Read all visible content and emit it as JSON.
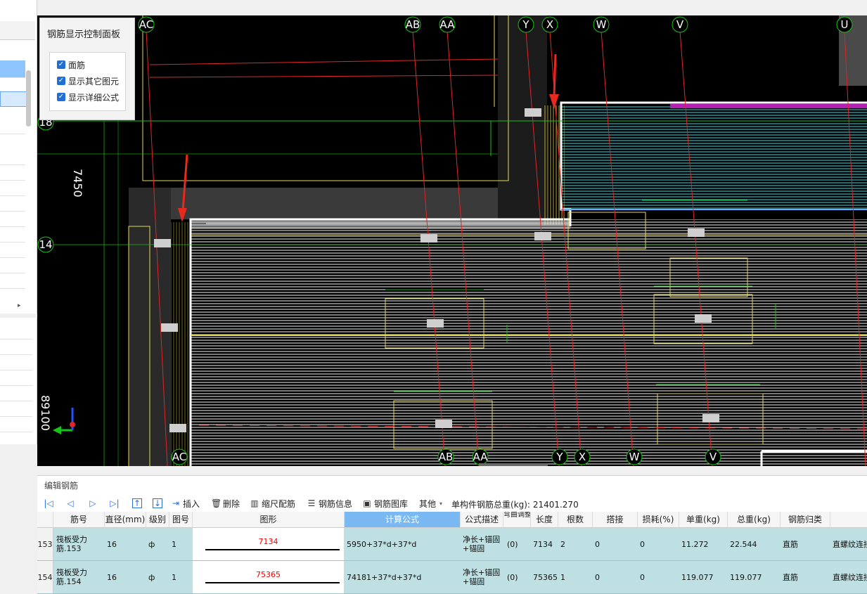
{
  "control_panel": {
    "title": "钢筋显示控制面板",
    "options": [
      {
        "label": "面筋",
        "checked": true
      },
      {
        "label": "显示其它图元",
        "checked": true
      },
      {
        "label": "显示详细公式",
        "checked": true
      }
    ]
  },
  "cad": {
    "axes_top": [
      "AC",
      "AB",
      "AA",
      "Y",
      "X",
      "W",
      "V",
      "U"
    ],
    "axes_bottom": [
      "AC",
      "AB",
      "AA",
      "Y",
      "X",
      "W",
      "V"
    ],
    "axes_left": [
      "18",
      "14"
    ],
    "dimensions": [
      "7450",
      "89100"
    ],
    "colors": {
      "background": "#000000",
      "hatch": "#f2f2f2",
      "cyan_hatch": "#39d8e6",
      "grid_green": "#17c517",
      "grid_red": "#e12626",
      "outline_yellow": "#e3d95a",
      "arrow": "#e8291d"
    }
  },
  "editor": {
    "title": "编辑钢筋",
    "toolbar": {
      "insert": "插入",
      "delete": "删除",
      "scale_rebar": "缩尺配筋",
      "rebar_info": "钢筋信息",
      "rebar_library": "钢筋图库",
      "other": "其他",
      "total_label": "单构件钢筋总重(kg):",
      "total_value": "21401.270"
    },
    "columns": [
      "筋号",
      "直径(mm)",
      "级别",
      "图号",
      "图形",
      "计算公式",
      "公式描述",
      "弯曲调整",
      "长度",
      "根数",
      "搭接",
      "损耗(%)",
      "单重(kg)",
      "总重(kg)",
      "钢筋归类",
      ""
    ],
    "rows": [
      {
        "num": "153",
        "name": "筏板受力筋.153",
        "diameter": "16",
        "grade": "ф",
        "fig_no": "1",
        "shape_value": "7134",
        "formula": "5950+37*d+37*d",
        "desc": "净长+锚固+锚固",
        "bend": "(0)",
        "length": "7134",
        "count": "2",
        "lap": "0",
        "loss": "0",
        "unit_weight": "11.272",
        "total_weight": "22.544",
        "category": "直筋",
        "extra": "直螺纹连接"
      },
      {
        "num": "154",
        "name": "筏板受力筋.154",
        "diameter": "16",
        "grade": "ф",
        "fig_no": "1",
        "shape_value": "75365",
        "formula": "74181+37*d+37*d",
        "desc": "净长+锚固+锚固",
        "bend": "(0)",
        "length": "75365",
        "count": "1",
        "lap": "0",
        "loss": "0",
        "unit_weight": "119.077",
        "total_weight": "119.077",
        "category": "直筋",
        "extra": "直螺纹连接"
      }
    ]
  }
}
